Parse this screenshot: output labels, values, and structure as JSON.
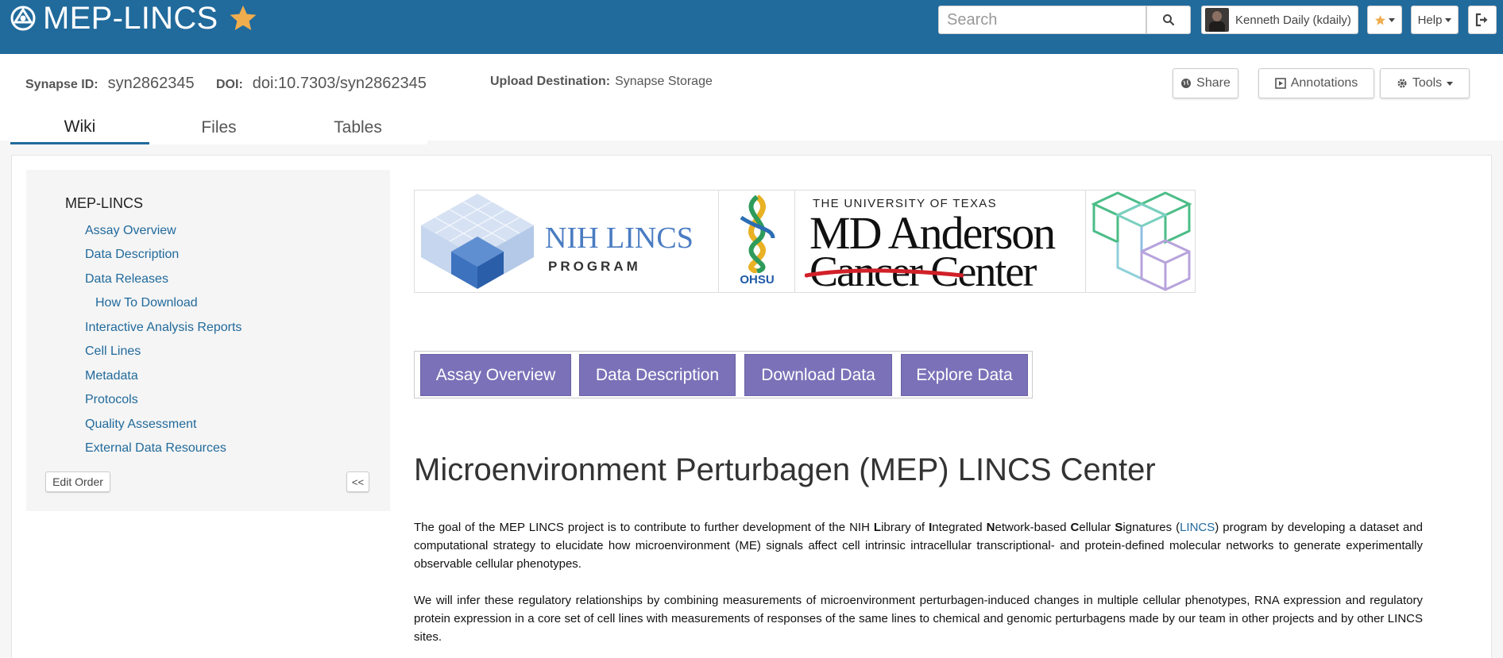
{
  "header": {
    "app_title": "MEP-LINCS",
    "search_placeholder": "Search",
    "user_name": "Kenneth Daily (kdaily)",
    "help_label": "Help",
    "colors": {
      "bar": "#216a9c",
      "star": "#f0ad4e"
    }
  },
  "entity": {
    "synapse_id_label": "Synapse ID:",
    "synapse_id": "syn2862345",
    "doi_label": "DOI:",
    "doi": "doi:10.7303/syn2862345",
    "upload_label": "Upload Destination:",
    "upload_value": "Synapse Storage",
    "share_label": "Share",
    "annotations_label": "Annotations",
    "tools_label": "Tools"
  },
  "tabs": [
    {
      "label": "Wiki",
      "active": true
    },
    {
      "label": "Files",
      "active": false
    },
    {
      "label": "Tables",
      "active": false
    }
  ],
  "sidebar": {
    "root": "MEP-LINCS",
    "items": [
      {
        "label": "Assay Overview",
        "level": 1
      },
      {
        "label": "Data Description",
        "level": 1
      },
      {
        "label": "Data Releases",
        "level": 1
      },
      {
        "label": "How To Download",
        "level": 2
      },
      {
        "label": "Interactive Analysis Reports",
        "level": 1
      },
      {
        "label": "Cell Lines",
        "level": 1
      },
      {
        "label": "Metadata",
        "level": 1
      },
      {
        "label": "Protocols",
        "level": 1
      },
      {
        "label": "Quality Assessment",
        "level": 1
      },
      {
        "label": "External Data Resources",
        "level": 1
      }
    ],
    "edit_order_label": "Edit Order",
    "collapse_label": "<<"
  },
  "logos": {
    "nih_line1": "NIH LINCS",
    "nih_line2": "PROGRAM",
    "ohsu": "OHSU",
    "mda_line1": "THE UNIVERSITY OF TEXAS",
    "mda_line2": "MD Anderson",
    "mda_line3": "Cancer Center"
  },
  "nav_buttons": [
    "Assay Overview",
    "Data Description",
    "Download Data",
    "Explore Data"
  ],
  "article": {
    "title": "Microenvironment Perturbagen (MEP) LINCS Center",
    "p1_a": "The goal of the MEP LINCS project is to contribute to further development of the NIH ",
    "p1_L": "L",
    "p1_b": "ibrary of ",
    "p1_I": "I",
    "p1_c": "ntegrated ",
    "p1_N": "N",
    "p1_d": "etwork-based ",
    "p1_C": "C",
    "p1_e": "ellular ",
    "p1_S": "S",
    "p1_f": "ignatures (",
    "p1_link": "LINCS",
    "p1_g": ") program by developing a dataset and computational strategy to elucidate how microenvironment (ME) signals affect cell intrinsic intracellular transcriptional- and protein-defined molecular networks to generate experimentally observable cellular phenotypes.",
    "p2": "We will infer these regulatory relationships by combining measurements of microenvironment perturbagen-induced changes in multiple cellular phenotypes, RNA expression and regulatory protein expression in a core set of cell lines with measurements of responses of the same lines to chemical and genomic perturbagens made by our team in other projects and by other LINCS sites."
  }
}
